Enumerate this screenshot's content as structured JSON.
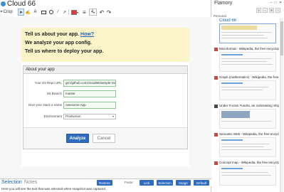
{
  "app": {
    "title": "Cloud 66"
  },
  "toolbar": {
    "crop_label": "Crop",
    "text_tool_label": "A",
    "line_width_label": "≡",
    "font_size_label": "4",
    "undo_glyph": "↶",
    "redo_glyph": "↷",
    "color_swatch": "#e53935"
  },
  "screenshot": {
    "banner": {
      "line1_prefix": "Tell us about your app. ",
      "line1_link": "How?",
      "line2": "We analyze your app config.",
      "line3": "Tell us where to deploy your app."
    },
    "panel": {
      "title": "About your app",
      "fields": [
        {
          "label": "Your Git Repo URL",
          "value": "git://github.com/cloud66/sample-rai"
        },
        {
          "label": "Git Branch",
          "value": "master"
        },
        {
          "label": "Give your stack a name",
          "value": "Awesome App"
        },
        {
          "label": "Environment",
          "value": "Production"
        }
      ],
      "analyze_label": "Analyze",
      "cancel_label": "Cancel"
    }
  },
  "bottom": {
    "tabs": [
      "Selection",
      "Notes"
    ],
    "restore_label": "Restore",
    "paste_label": "Paste:",
    "paste_buttons": [
      "Link",
      "Selection",
      "Image",
      "Default"
    ],
    "status_text": "Here you will see the text that was selected when snapshot was captured."
  },
  "flamory": {
    "title": "Flamory",
    "personal_label": "Personal",
    "items": [
      {
        "label": "Cloud 66"
      },
      {
        "label": "Microformat - Wikipedia, the free encyclopedi"
      },
      {
        "label": "Graph (mathematics) - Wikipedia, the free encycl"
      },
      {
        "label": "Under Frozen Tundra, an Icebreaking Ship Unco"
      },
      {
        "label": "Semantic Web - Wikipedia, the free encyclopedi"
      },
      {
        "label": "Concept map - Wikipedia, the free encyclopedia"
      }
    ]
  }
}
